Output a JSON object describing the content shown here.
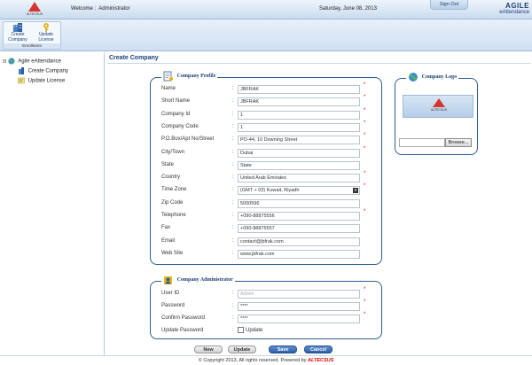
{
  "header": {
    "logo_text": "ALTECSUS",
    "welcome_label": "Welcome",
    "welcome_user": "Administrator",
    "date": "Saturday, June 08, 2013",
    "signout": "Sign Out",
    "brand_name": "AGILE",
    "brand_product": "eAttendance"
  },
  "ribbon": {
    "group_name": "Enrollment",
    "buttons": [
      {
        "line1": "Create",
        "line2": "Company",
        "icon": "building-icon"
      },
      {
        "line1": "Update",
        "line2": "License",
        "icon": "key-icon"
      }
    ]
  },
  "sidebar": {
    "root": "Agile eAttendance",
    "items": [
      "Create Company",
      "Update License"
    ]
  },
  "main": {
    "title": "Create Company",
    "profile": {
      "legend": "Company Profile",
      "fields": [
        {
          "label": "Name",
          "value": "JBFRAK",
          "required": true
        },
        {
          "label": "Short Name",
          "value": "JBFRAK",
          "required": true
        },
        {
          "label": "Company Id",
          "value": "1",
          "required": true
        },
        {
          "label": "Company Code",
          "value": "1",
          "required": true
        },
        {
          "label": "P.O.Box/Apt No/Street",
          "value": "PO-44, 10 Downing Street",
          "required": true
        },
        {
          "label": "City/Town",
          "value": "Dubai",
          "required": true
        },
        {
          "label": "State",
          "value": "State",
          "required": false
        },
        {
          "label": "Country",
          "value": "United Arab Emirates",
          "required": true
        },
        {
          "label": "Time Zone",
          "value": "(GMT + 03) Kuwait, Riyadh",
          "required": true,
          "select": true
        },
        {
          "label": "Zip Code",
          "value": "5000596",
          "required": false
        },
        {
          "label": "Telephone",
          "value": "+090-88875556",
          "required": true
        },
        {
          "label": "Fax",
          "value": "+090-88875557",
          "required": false
        },
        {
          "label": "Email",
          "value": "contact@jbfrak.com",
          "required": false
        },
        {
          "label": "Web Site",
          "value": "www.jbfrak.com",
          "required": false
        }
      ]
    },
    "logo_box": {
      "legend": "Company Logo",
      "browse": "Browse..."
    },
    "admin": {
      "legend": "Company Administrator",
      "fields": [
        {
          "label": "User ID",
          "value": "Admin",
          "required": true,
          "placeholder": true
        },
        {
          "label": "Password",
          "value": "****",
          "required": true
        },
        {
          "label": "Confirm Password",
          "value": "****",
          "required": true
        }
      ],
      "update_password_label": "Update Password",
      "update_checkbox_label": "Update"
    },
    "buttons": {
      "new": "New",
      "update": "Update",
      "save": "Save",
      "cancel": "Cancel"
    }
  },
  "footer": {
    "text": "© Copyright 2013, All rights reserved. Powered by",
    "brand": "ALTECSUS"
  }
}
